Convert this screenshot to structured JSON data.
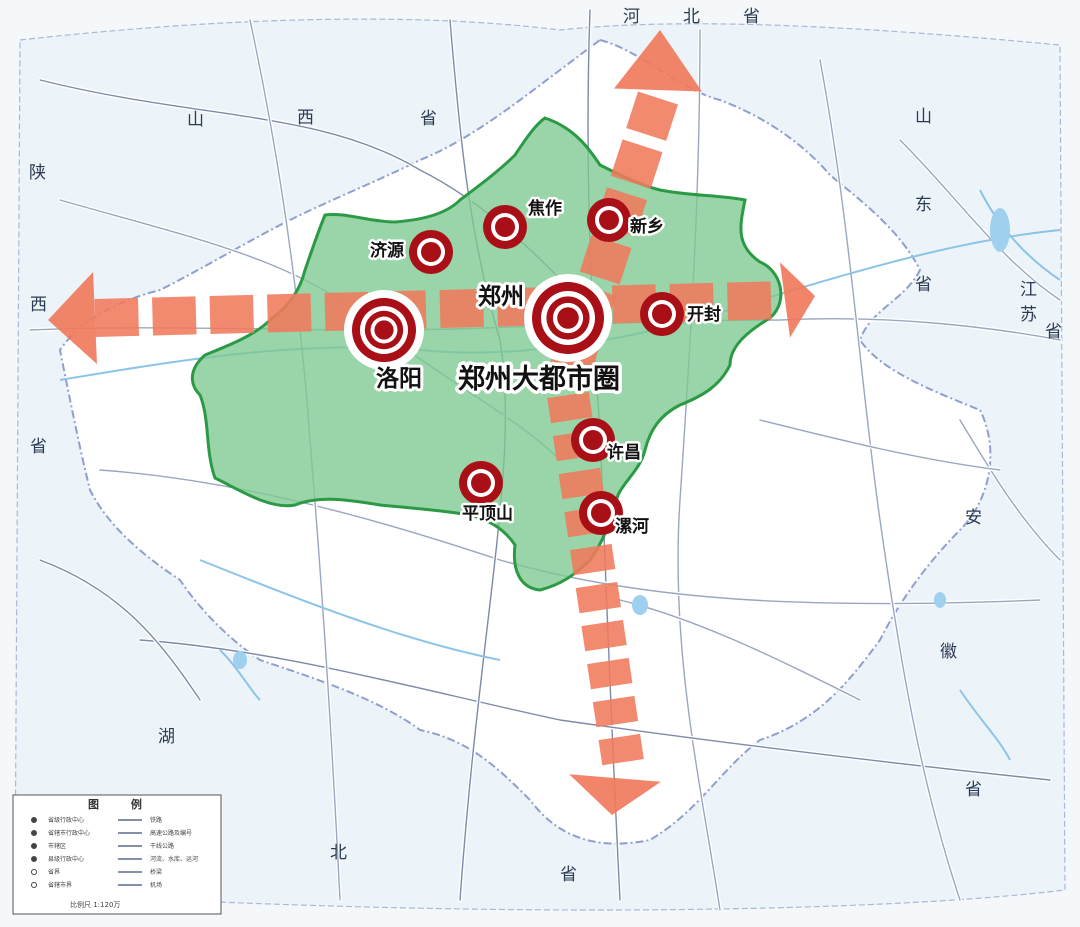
{
  "provinces": [
    "河",
    "北",
    "省",
    "山",
    "西",
    "省",
    "陕",
    "西",
    "省",
    "山",
    "东",
    "省",
    "江",
    "苏",
    "省",
    "安",
    "徽",
    "省",
    "湖",
    "北",
    "省"
  ],
  "cities": [
    {
      "id": "zhengzhou",
      "label": "郑州",
      "icon": "major-city-marker"
    },
    {
      "id": "luoyang",
      "label": "洛阳",
      "icon": "major-city-marker"
    },
    {
      "id": "kaifeng",
      "label": "开封",
      "icon": "city-marker"
    },
    {
      "id": "xinxiang",
      "label": "新乡",
      "icon": "city-marker"
    },
    {
      "id": "jiaozuo",
      "label": "焦作",
      "icon": "city-marker"
    },
    {
      "id": "jiyuan",
      "label": "济源",
      "icon": "city-marker"
    },
    {
      "id": "xuchang",
      "label": "许昌",
      "icon": "city-marker"
    },
    {
      "id": "pingdingshan",
      "label": "平顶山",
      "icon": "city-marker"
    },
    {
      "id": "luohe",
      "label": "漯河",
      "icon": "city-marker"
    }
  ],
  "region_label": "郑州大都市圈",
  "legend": {
    "title": "图 例",
    "items": [
      "省级行政中心",
      "省辖市行政中心",
      "市辖区",
      "县级行政中心",
      "省界",
      "省辖市界",
      "铁路",
      "高速公路及编号",
      "干线公路",
      "河流、水库、运河",
      "桥梁",
      "机场"
    ],
    "scale": "比例尺 1:120万"
  },
  "colors": {
    "region_fill": "#7cc98f",
    "region_border": "#2c9a45",
    "arrow": "#f07a5c",
    "marker": "#a90f16",
    "background": "#f4f8fb"
  }
}
